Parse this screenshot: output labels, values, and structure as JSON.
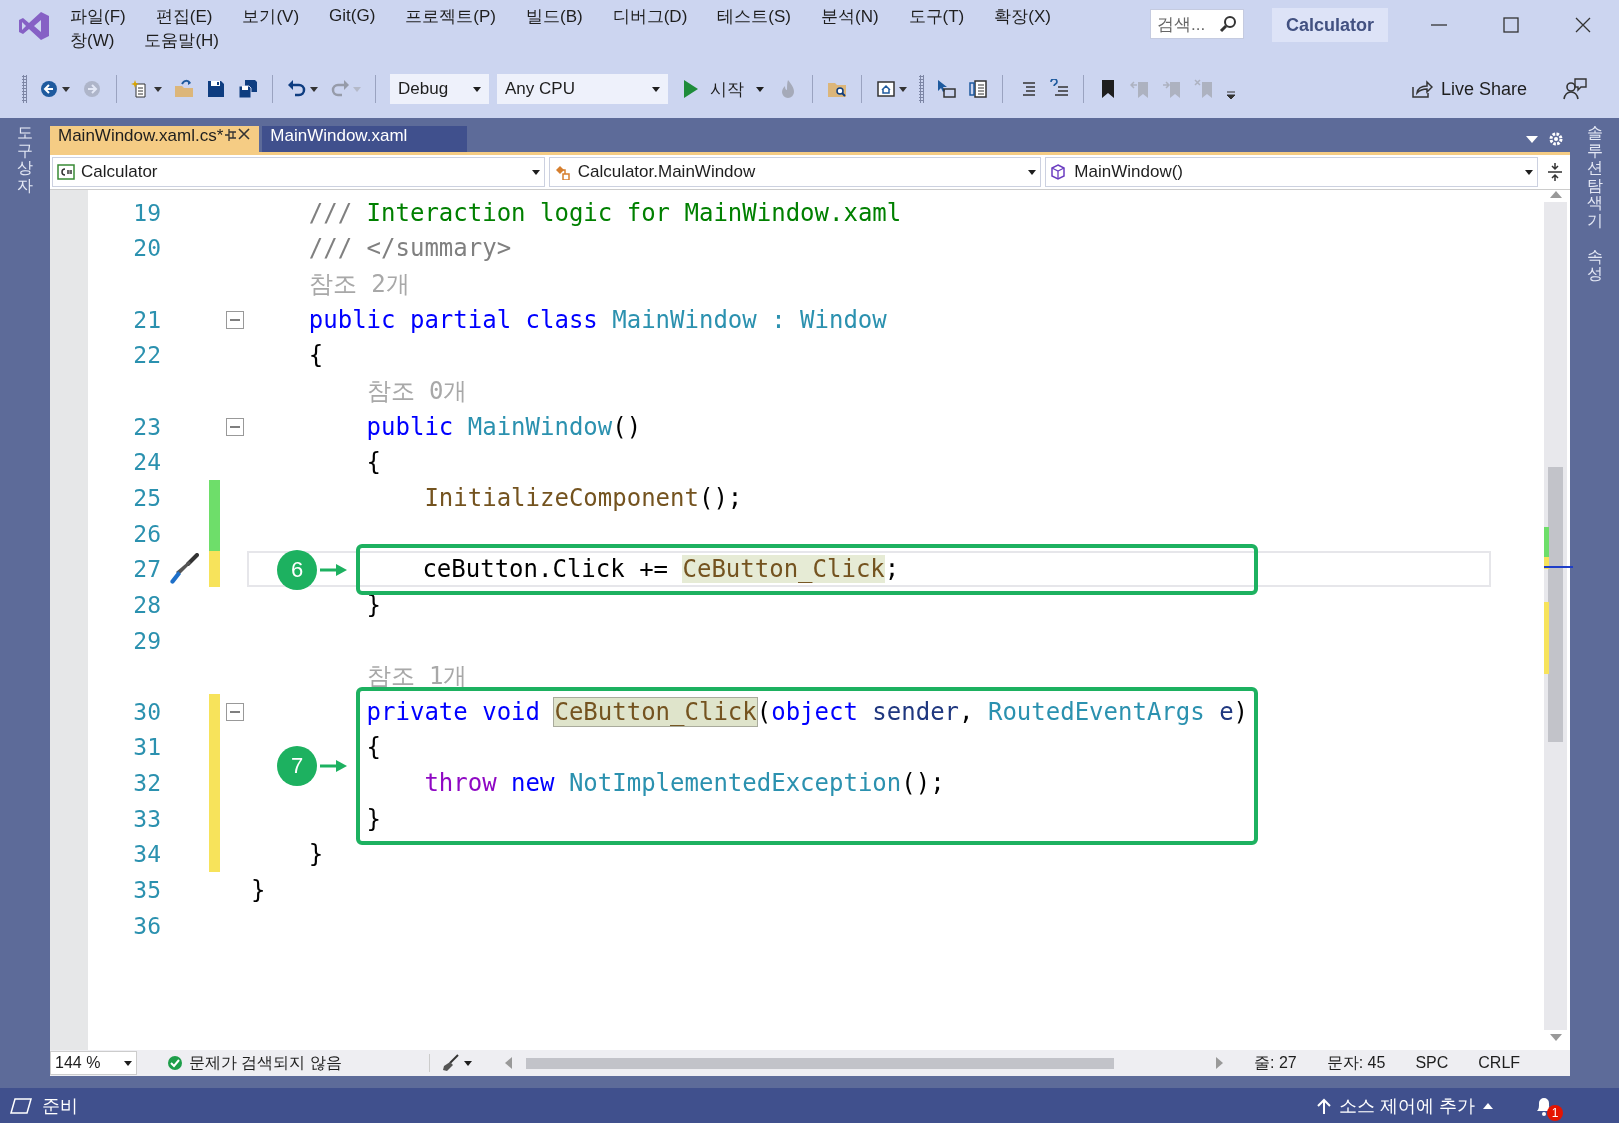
{
  "window": {
    "title": "Calculator",
    "search": {
      "placeholder": "검색..."
    }
  },
  "menu": [
    {
      "label": "파일(F)"
    },
    {
      "label": "편집(E)"
    },
    {
      "label": "보기(V)"
    },
    {
      "label": "Git(G)"
    },
    {
      "label": "프로젝트(P)"
    },
    {
      "label": "빌드(B)"
    },
    {
      "label": "디버그(D)"
    },
    {
      "label": "테스트(S)"
    },
    {
      "label": "분석(N)"
    },
    {
      "label": "도구(T)"
    },
    {
      "label": "확장(X)"
    },
    {
      "label": "창(W)"
    },
    {
      "label": "도움말(H)"
    }
  ],
  "toolbar": {
    "items": [
      {
        "kind": "grip"
      },
      {
        "kind": "icon",
        "disabled": false,
        "caret": true
      },
      {
        "kind": "icon",
        "disabled": true,
        "caret": false
      },
      {
        "kind": "separator"
      },
      {
        "kind": "icon",
        "disabled": false,
        "caret": true
      },
      {
        "kind": "icon",
        "disabled": false,
        "caret": false
      },
      {
        "kind": "icon",
        "disabled": false,
        "caret": false
      },
      {
        "kind": "icon",
        "disabled": false,
        "caret": false
      },
      {
        "kind": "separator"
      },
      {
        "kind": "icon",
        "disabled": false,
        "caret": true
      },
      {
        "kind": "icon",
        "disabled": true,
        "caret": true
      },
      {
        "kind": "separator"
      },
      {
        "kind": "dropdown",
        "value": "Debug"
      },
      {
        "kind": "dropdown",
        "value": "Any CPU"
      },
      {
        "kind": "run",
        "label": "시작"
      },
      {
        "kind": "icon",
        "disabled": true,
        "caret": false
      },
      {
        "kind": "separator"
      },
      {
        "kind": "icon",
        "disabled": false,
        "caret": false
      },
      {
        "kind": "separator"
      },
      {
        "kind": "icon",
        "disabled": false,
        "caret": true
      },
      {
        "kind": "grip"
      },
      {
        "kind": "icon",
        "disabled": false,
        "caret": false
      },
      {
        "kind": "icon",
        "disabled": false,
        "caret": false
      },
      {
        "kind": "separator"
      },
      {
        "kind": "icon",
        "disabled": false,
        "caret": false
      },
      {
        "kind": "icon",
        "disabled": false,
        "caret": false
      },
      {
        "kind": "separator"
      },
      {
        "kind": "icon",
        "disabled": false,
        "caret": false
      },
      {
        "kind": "icon",
        "disabled": true,
        "caret": false
      },
      {
        "kind": "icon",
        "disabled": true,
        "caret": false
      },
      {
        "kind": "icon",
        "disabled": true,
        "caret": false
      },
      {
        "kind": "overflow"
      }
    ],
    "live_share": "Live Share"
  },
  "left_panels": [
    {
      "label": "도구 상자"
    }
  ],
  "right_panels": [
    {
      "label": "솔루션 탐색기"
    },
    {
      "label": "속성"
    }
  ],
  "tabs": [
    {
      "label": "MainWindow.xaml.cs*",
      "selected": true
    },
    {
      "label": "MainWindow.xaml",
      "selected": false
    }
  ],
  "navigation": [
    {
      "kind": "project",
      "value": "Calculator"
    },
    {
      "kind": "class",
      "value": "Calculator.MainWindow"
    },
    {
      "kind": "method",
      "value": "MainWindow()"
    }
  ],
  "code": [
    {
      "kind": "block",
      "children": [
        {
          "kind": "code",
          "number": "19",
          "current": false,
          "tokens": [
            {
              "kind": "doc",
              "t": "///"
            },
            {
              "kind": "doc_text",
              "t": " Interaction logic for MainWindow.xaml"
            }
          ]
        },
        {
          "kind": "code",
          "number": "20",
          "current": false,
          "tokens": [
            {
              "kind": "doc",
              "t": "/// </summary>"
            }
          ]
        },
        {
          "kind": "lens",
          "text": "참조 2개"
        },
        {
          "kind": "fold",
          "number": "21",
          "expanded": true,
          "current": false,
          "tokens": [
            {
              "kind": "keyword",
              "t": "public partial class "
            },
            {
              "kind": "type",
              "t": "MainWindow : Window"
            }
          ]
        },
        {
          "kind": "code",
          "number": "22",
          "current": false,
          "tokens": [
            {
              "kind": "plain",
              "t": "{"
            }
          ]
        },
        {
          "kind": "block",
          "children": [
            {
              "kind": "lens",
              "text": "참조 0개"
            },
            {
              "kind": "fold",
              "number": "23",
              "expanded": true,
              "current": false,
              "tokens": [
                {
                  "kind": "keyword",
                  "t": "public "
                },
                {
                  "kind": "type",
                  "t": "MainWindow"
                },
                {
                  "kind": "plain",
                  "t": "()"
                }
              ]
            },
            {
              "kind": "code",
              "number": "24",
              "current": false,
              "tokens": [
                {
                  "kind": "plain",
                  "t": "{"
                }
              ]
            },
            {
              "kind": "block",
              "children": [
                {
                  "kind": "code",
                  "number": "25",
                  "color": "#6ede6a",
                  "current": false,
                  "tokens": [
                    {
                      "kind": "method",
                      "t": "InitializeComponent"
                    },
                    {
                      "kind": "plain",
                      "t": "();"
                    }
                  ]
                },
                {
                  "kind": "code",
                  "number": "26",
                  "color": "#6ede6a",
                  "current": false
                },
                {
                  "kind": "code",
                  "number": "27",
                  "color": "#f7e35b",
                  "current": true,
                  "quick_action": true,
                  "callout": "6",
                  "callout_end": true,
                  "tokens": [
                    {
                      "kind": "plain",
                      "t": "ceButton.Click += "
                    },
                    {
                      "kind": "reference",
                      "t": "CeButton_Click"
                    },
                    {
                      "kind": "plain",
                      "t": ";"
                    }
                  ]
                }
              ]
            },
            {
              "kind": "code",
              "number": "28",
              "current": false,
              "tokens": [
                {
                  "kind": "plain",
                  "t": "}"
                }
              ]
            },
            {
              "kind": "code",
              "number": "29",
              "current": false
            },
            {
              "kind": "lens",
              "text": "참조 1개"
            },
            {
              "kind": "fold",
              "number": "30",
              "expanded": true,
              "color": "#f7e35b",
              "current": false,
              "callout": "7",
              "tokens": [
                {
                  "kind": "keyword",
                  "t": "private void "
                },
                {
                  "kind": "definition",
                  "t": "CeButton_Click"
                },
                {
                  "kind": "plain",
                  "t": "("
                },
                {
                  "kind": "keyword",
                  "t": "object"
                },
                {
                  "kind": "param",
                  "t": " sender"
                },
                {
                  "kind": "plain",
                  "t": ", "
                },
                {
                  "kind": "type",
                  "t": "RoutedEventArgs"
                },
                {
                  "kind": "param",
                  "t": " e"
                },
                {
                  "kind": "plain",
                  "t": ")"
                }
              ]
            },
            {
              "kind": "code",
              "number": "31",
              "color": "#f7e35b",
              "current": false,
              "tokens": [
                {
                  "kind": "plain",
                  "t": "{"
                }
              ]
            },
            {
              "kind": "block",
              "children": [
                {
                  "kind": "code",
                  "number": "32",
                  "color": "#f7e35b",
                  "current": false,
                  "tokens": [
                    {
                      "kind": "control",
                      "t": "throw "
                    },
                    {
                      "kind": "keyword",
                      "t": "new "
                    },
                    {
                      "kind": "type",
                      "t": "NotImplementedException"
                    },
                    {
                      "kind": "plain",
                      "t": "();"
                    }
                  ]
                }
              ]
            },
            {
              "kind": "code",
              "number": "33",
              "color": "#f7e35b",
              "current": false,
              "callout_end": true,
              "tokens": [
                {
                  "kind": "plain",
                  "t": "}"
                }
              ]
            }
          ]
        },
        {
          "kind": "code",
          "number": "34",
          "color": "#f7e35b",
          "current": false,
          "tokens": [
            {
              "kind": "plain",
              "t": "}"
            }
          ]
        }
      ]
    },
    {
      "kind": "code",
      "number": "35",
      "current": false,
      "tokens": [
        {
          "kind": "plain",
          "t": "}"
        }
      ]
    },
    {
      "kind": "code",
      "number": "36",
      "current": false
    }
  ],
  "editor_status": {
    "zoom": "144 %",
    "issues": "문제가 검색되지 않음",
    "line": "줄: 27",
    "column": "문자: 45",
    "whitespace": "SPC",
    "line_ending": "CRLF"
  },
  "status_bar": {
    "text": "준비",
    "source_control": "소스 제어에 추가",
    "notifications": "1"
  }
}
